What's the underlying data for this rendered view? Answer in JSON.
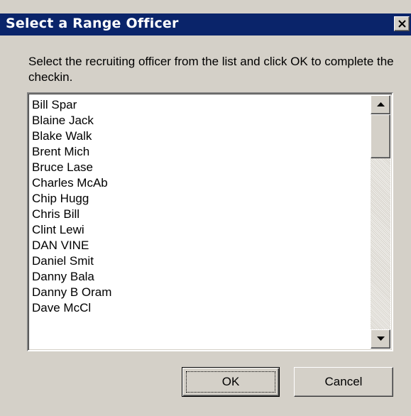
{
  "dialog": {
    "title": "Select a Range Officer",
    "close_icon": "close-icon",
    "prompt": "Select the recruiting officer from the list and click OK to complete the checkin."
  },
  "officer_list": {
    "items": [
      "Bill Spar",
      "Blaine Jack",
      "Blake Walk",
      "Brent Mich",
      "Bruce Lase",
      "Charles McAb",
      "Chip Hugg",
      "Chris Bill",
      "Clint Lewi",
      "DAN VINE",
      "Daniel Smit",
      "Danny Bala",
      "Danny B Oram",
      "Dave McCl"
    ],
    "scroll_up_icon": "arrow-up-icon",
    "scroll_down_icon": "arrow-down-icon"
  },
  "buttons": {
    "ok_label": "OK",
    "cancel_label": "Cancel"
  },
  "colors": {
    "titlebar": "#0a246a",
    "face": "#d4d0c8"
  }
}
